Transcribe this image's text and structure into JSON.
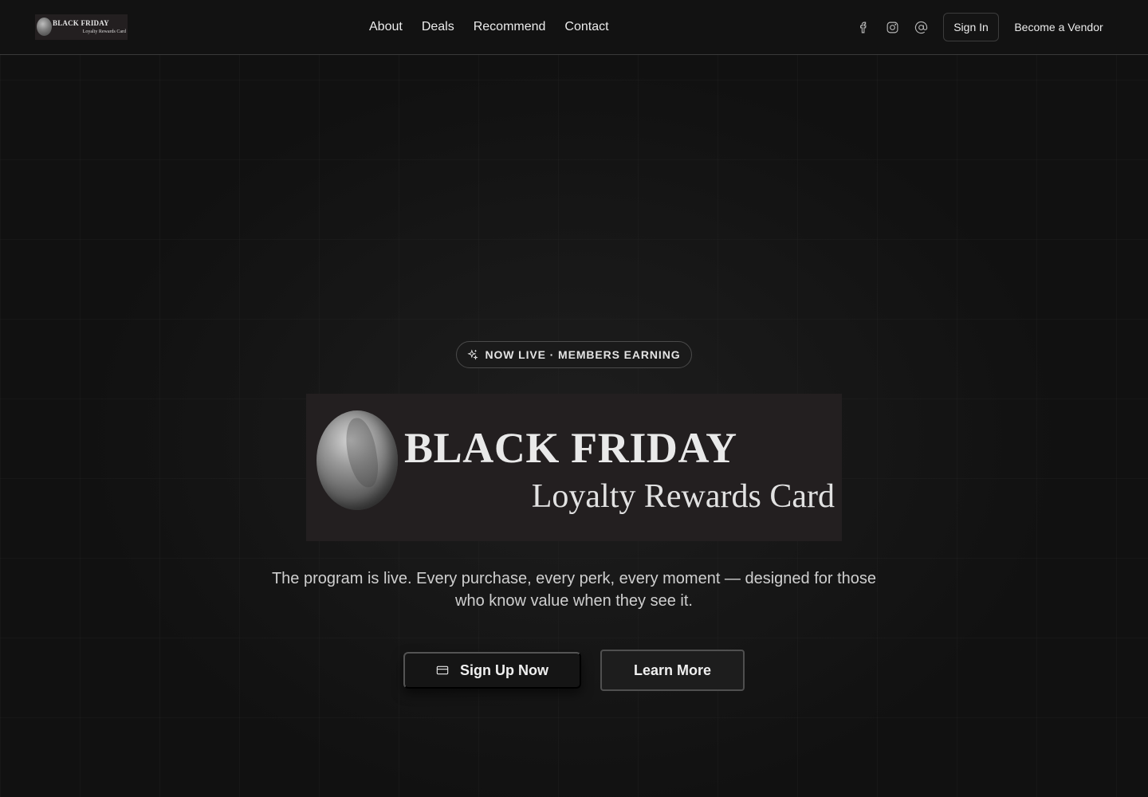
{
  "header": {
    "logo": {
      "line1": "BLACK FRIDAY",
      "line2": "Loyalty Rewards Card"
    },
    "nav": [
      {
        "label": "About"
      },
      {
        "label": "Deals"
      },
      {
        "label": "Recommend"
      },
      {
        "label": "Contact"
      }
    ],
    "social_icons": [
      "facebook-icon",
      "instagram-icon",
      "at-sign-icon"
    ],
    "sign_in_label": "Sign In",
    "vendor_label": "Become a Vendor"
  },
  "hero": {
    "badge": {
      "icon": "sparkles-icon",
      "text": "NOW LIVE · MEMBERS EARNING"
    },
    "logo": {
      "line1": "BLACK FRIDAY",
      "line2": "Loyalty Rewards Card"
    },
    "tagline": "The program is live. Every purchase, every perk, every moment — designed for those who know value when they see it.",
    "primary_button": {
      "icon": "credit-card-icon",
      "label": "Sign Up Now"
    },
    "secondary_button": {
      "label": "Learn More"
    }
  },
  "colors": {
    "background": "#111111",
    "header_background": "#121212",
    "text": "#ececec",
    "muted_text": "#cfcfcf",
    "border": "#3a3a3a"
  }
}
